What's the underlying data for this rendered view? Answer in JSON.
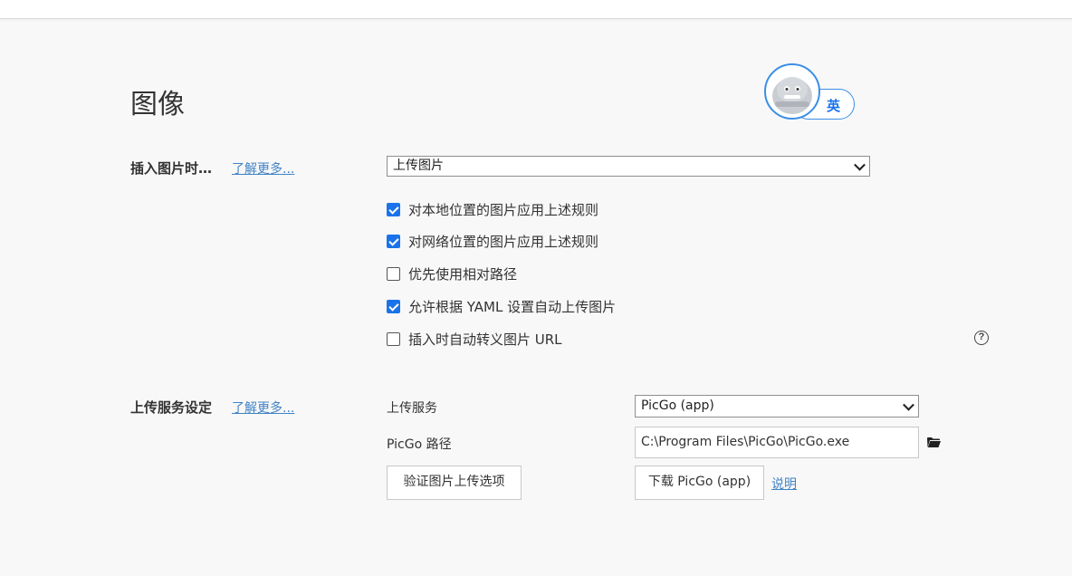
{
  "page": {
    "title": "图像"
  },
  "ime": {
    "label": "英"
  },
  "insert_section": {
    "label": "插入图片时…",
    "learn_more": "了解更多...",
    "select_value": "上传图片",
    "options": [
      {
        "label": "对本地位置的图片应用上述规则",
        "checked": true
      },
      {
        "label": "对网络位置的图片应用上述规则",
        "checked": true
      },
      {
        "label": "优先使用相对路径",
        "checked": false
      },
      {
        "label": "允许根据 YAML 设置自动上传图片",
        "checked": true
      },
      {
        "label": "插入时自动转义图片 URL",
        "checked": false
      }
    ],
    "help_icon": "question-circle-icon"
  },
  "upload_section": {
    "label": "上传服务设定",
    "learn_more": "了解更多...",
    "service_label": "上传服务",
    "service_value": "PicGo (app)",
    "path_label": "PicGo 路径",
    "path_value": "C:\\Program Files\\PicGo\\PicGo.exe",
    "folder_icon": "folder-icon",
    "verify_button": "验证图片上传选项",
    "download_button": "下载 PicGo (app)",
    "help_link": "说明"
  },
  "colors": {
    "accent": "#1a73e8",
    "link": "#4183c4",
    "background": "#f8f8f8"
  }
}
